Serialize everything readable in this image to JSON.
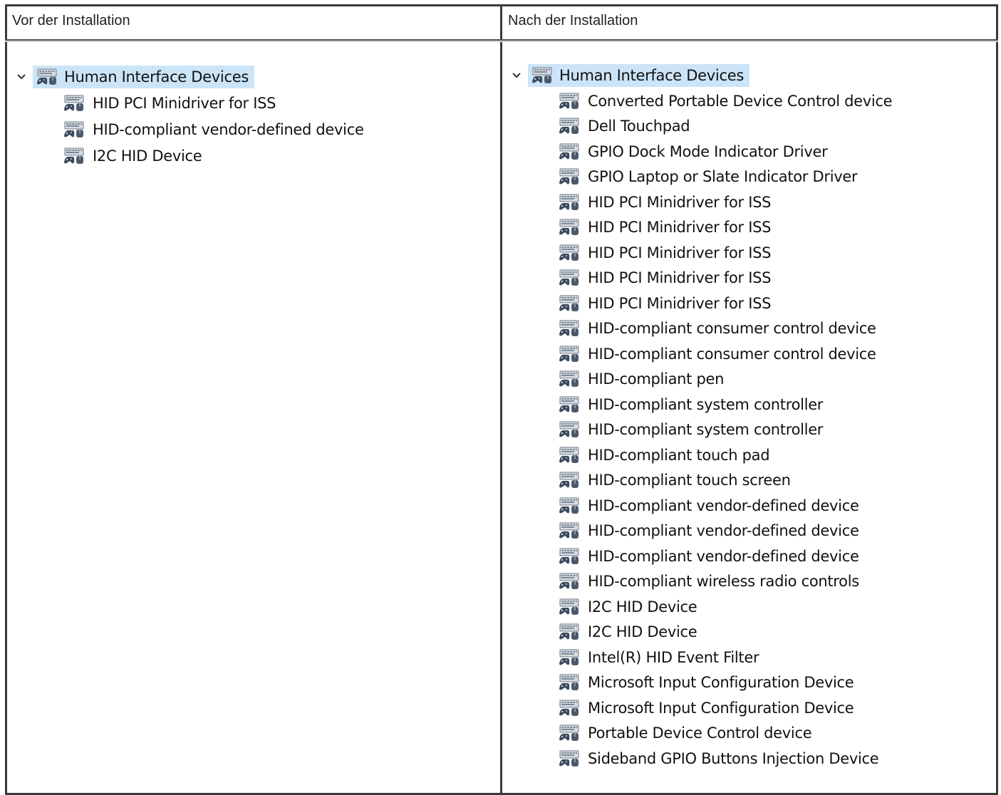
{
  "columns": {
    "before": {
      "header": "Vor der Installation",
      "root": "Human Interface Devices",
      "items": [
        "HID PCI Minidriver for ISS",
        "HID-compliant vendor-defined device",
        "I2C HID Device"
      ]
    },
    "after": {
      "header": "Nach der Installation",
      "root": "Human Interface Devices",
      "items": [
        "Converted Portable Device Control device",
        "Dell Touchpad",
        "GPIO Dock Mode Indicator Driver",
        "GPIO Laptop or Slate Indicator Driver",
        "HID PCI Minidriver for ISS",
        "HID PCI Minidriver for ISS",
        "HID PCI Minidriver for ISS",
        "HID PCI Minidriver for ISS",
        "HID PCI Minidriver for ISS",
        "HID-compliant consumer control device",
        "HID-compliant consumer control device",
        "HID-compliant pen",
        "HID-compliant system controller",
        "HID-compliant system controller",
        "HID-compliant touch pad",
        "HID-compliant touch screen",
        "HID-compliant vendor-defined device",
        "HID-compliant vendor-defined device",
        "HID-compliant vendor-defined device",
        "HID-compliant wireless radio controls",
        "I2C HID Device",
        "I2C HID Device",
        "Intel(R) HID Event Filter",
        "Microsoft Input Configuration Device",
        "Microsoft Input Configuration Device",
        "Portable Device Control device",
        "Sideband GPIO Buttons Injection Device"
      ]
    }
  },
  "icons": {
    "chevron": "chevron-down-icon",
    "device": "hid-device-icon"
  },
  "colors": {
    "selection": "#cce4f7",
    "border": "#3a3a3a"
  }
}
